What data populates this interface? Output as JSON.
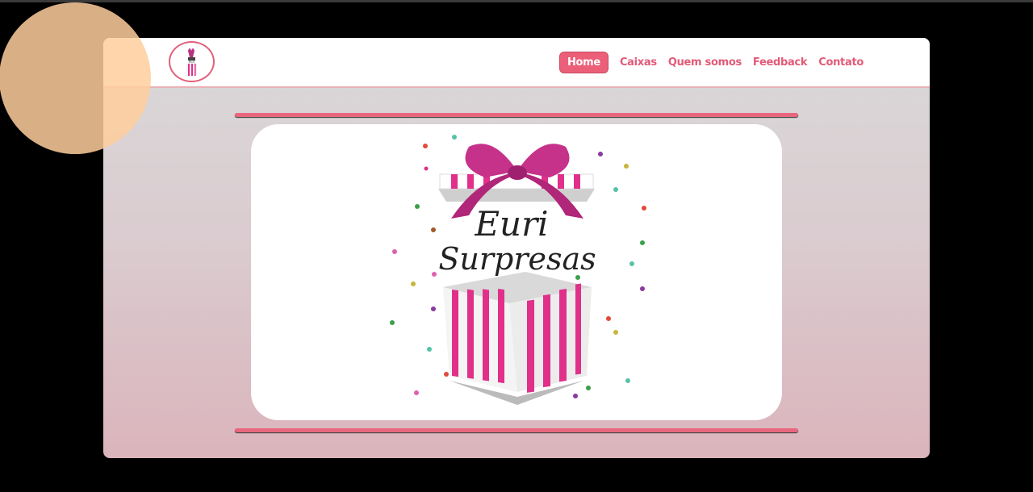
{
  "nav": {
    "items": [
      {
        "label": "Home",
        "active": true
      },
      {
        "label": "Caixas",
        "active": false
      },
      {
        "label": "Quem somos",
        "active": false
      },
      {
        "label": "Feedback",
        "active": false
      },
      {
        "label": "Contato",
        "active": false
      }
    ]
  },
  "banner": {
    "text_line1": "Euri",
    "text_line2": "Surpresas"
  },
  "colors": {
    "accent": "#ec5f78",
    "bow": "#c6318a",
    "stripe": "#e0308a"
  }
}
